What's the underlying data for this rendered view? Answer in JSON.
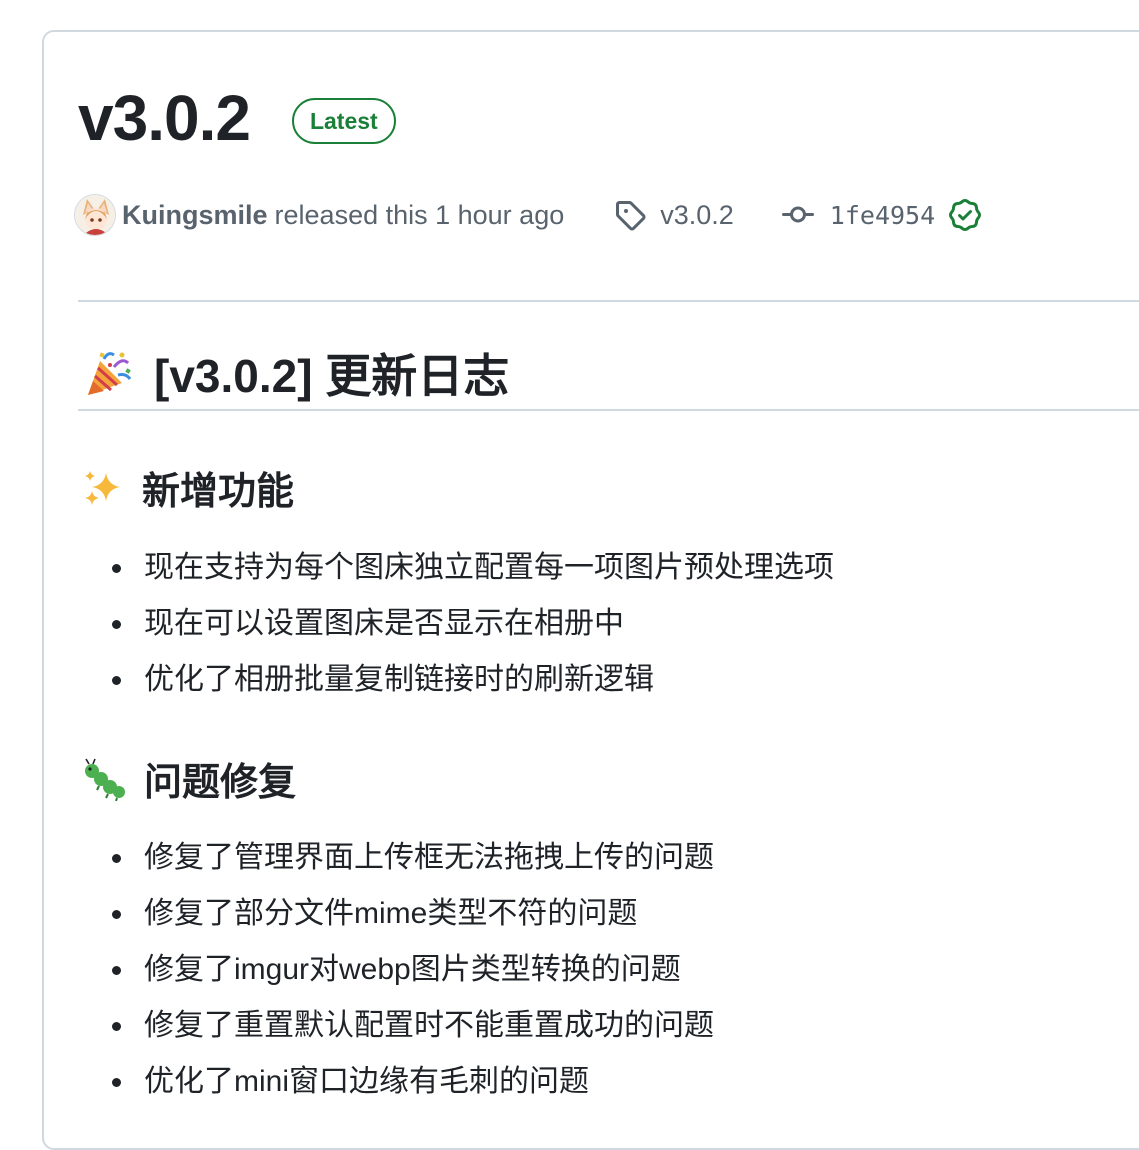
{
  "release": {
    "title": "v3.0.2",
    "badge": "Latest",
    "author": "Kuingsmile",
    "released_text": "released this 1 hour ago",
    "tag": "v3.0.2",
    "commit": "1fe4954"
  },
  "notes": {
    "heading": "[v3.0.2] 更新日志",
    "heading_icon": "party-popper-emoji",
    "sections": [
      {
        "icon": "sparkles-emoji",
        "title": "新增功能",
        "items": [
          "现在支持为每个图床独立配置每一项图片预处理选项",
          "现在可以设置图床是否显示在相册中",
          "优化了相册批量复制链接时的刷新逻辑"
        ]
      },
      {
        "icon": "bug-emoji",
        "title": "问题修复",
        "items": [
          "修复了管理界面上传框无法拖拽上传的问题",
          "修复了部分文件mime类型不符的问题",
          "修复了imgur对webp图片类型转换的问题",
          "修复了重置默认配置时不能重置成功的问题",
          "优化了mini窗口边缘有毛刺的问题"
        ]
      }
    ]
  },
  "colors": {
    "text": "#1f2328",
    "muted": "#59636e",
    "border": "#d1d9e0",
    "success": "#1a7f37"
  }
}
